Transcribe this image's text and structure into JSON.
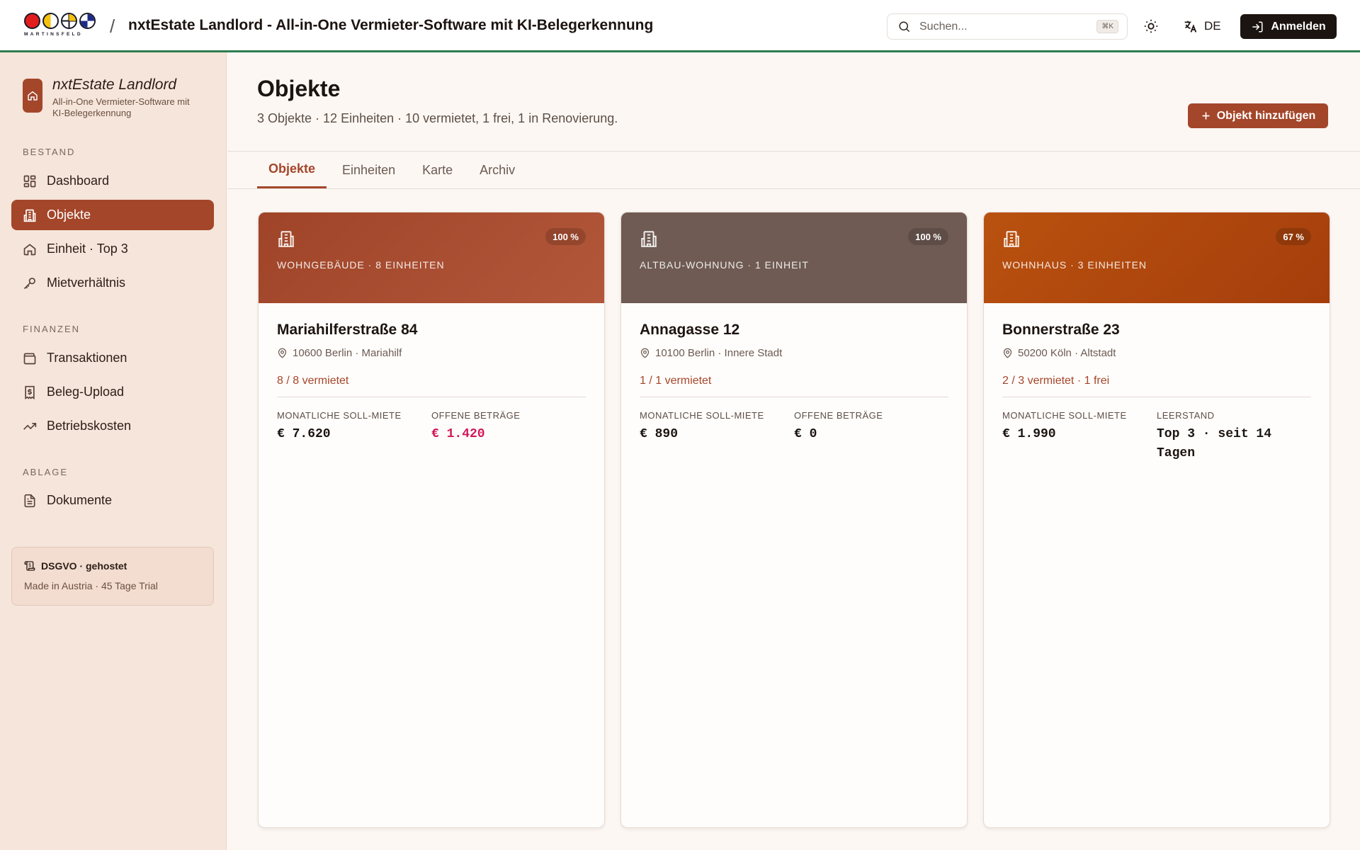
{
  "header": {
    "logo_word": "MARTINSFELD",
    "separator": "/",
    "title": "nxtEstate Landlord - All-in-One Vermieter-Software mit KI-Belegerkennung",
    "search_placeholder": "Suchen...",
    "search_shortcut": "⌘K",
    "language": "DE",
    "login_label": "Anmelden"
  },
  "sidebar": {
    "brand_name": "nxtEstate Landlord",
    "brand_sub": "All-in-One Vermieter-Software mit KI-Belegerkennung",
    "sections": [
      {
        "label": "BESTAND",
        "items": [
          {
            "label": "Dashboard",
            "icon": "grid-icon"
          },
          {
            "label": "Objekte",
            "icon": "building-icon",
            "active": true
          },
          {
            "label": "Einheit · Top 3",
            "icon": "home-icon"
          },
          {
            "label": "Mietverhältnis",
            "icon": "key-icon"
          }
        ]
      },
      {
        "label": "FINANZEN",
        "items": [
          {
            "label": "Transaktionen",
            "icon": "wallet-icon"
          },
          {
            "label": "Beleg-Upload",
            "icon": "receipt-icon"
          },
          {
            "label": "Betriebskosten",
            "icon": "trend-icon"
          }
        ]
      },
      {
        "label": "ABLAGE",
        "items": [
          {
            "label": "Dokumente",
            "icon": "document-icon"
          }
        ]
      }
    ],
    "notice_title": "DSGVO · gehostet",
    "notice_sub": "Made in Austria · 45 Tage Trial"
  },
  "main": {
    "title": "Objekte",
    "subtitle": "3 Objekte · 12 Einheiten · 10 vermietet, 1 frei, 1 in Renovierung.",
    "add_button": "Objekt hinzufügen",
    "tabs": [
      "Objekte",
      "Einheiten",
      "Karte",
      "Archiv"
    ],
    "active_tab": "Objekte",
    "properties": [
      {
        "percent": "100 %",
        "kind": "WOHNGEBÄUDE · 8 EINHEITEN",
        "address": "Mariahilferstraße 84",
        "location": "10600 Berlin · Mariahilf",
        "occupancy": "8 / 8 vermietet",
        "stat1_label": "MONATLICHE SOLL-MIETE",
        "stat1_value": "€ 7.620",
        "stat2_label": "OFFENE BETRÄGE",
        "stat2_value": "€ 1.420",
        "stat2_alert": true,
        "header_color": "#a4462a"
      },
      {
        "percent": "100 %",
        "kind": "ALTBAU-WOHNUNG · 1 EINHEIT",
        "address": "Annagasse 12",
        "location": "10100 Berlin · Innere Stadt",
        "occupancy": "1 / 1 vermietet",
        "stat1_label": "MONATLICHE SOLL-MIETE",
        "stat1_value": "€ 890",
        "stat2_label": "OFFENE BETRÄGE",
        "stat2_value": "€ 0",
        "stat2_alert": false,
        "header_color": "#6f5b53"
      },
      {
        "percent": "67 %",
        "kind": "WOHNHAUS · 3 EINHEITEN",
        "address": "Bonnerstraße 23",
        "location": "50200 Köln · Altstadt",
        "occupancy": "2 / 3 vermietet · 1 frei",
        "stat1_label": "MONATLICHE SOLL-MIETE",
        "stat1_value": "€ 1.990",
        "stat2_label": "LEERSTAND",
        "stat2_value": "Top 3 · seit 14 Tagen",
        "stat2_alert": false,
        "header_color": "#b5480f"
      }
    ]
  },
  "colors": {
    "accent": "#a4462a",
    "header_underline": "#2e7d4f",
    "alert": "#d0185c"
  }
}
